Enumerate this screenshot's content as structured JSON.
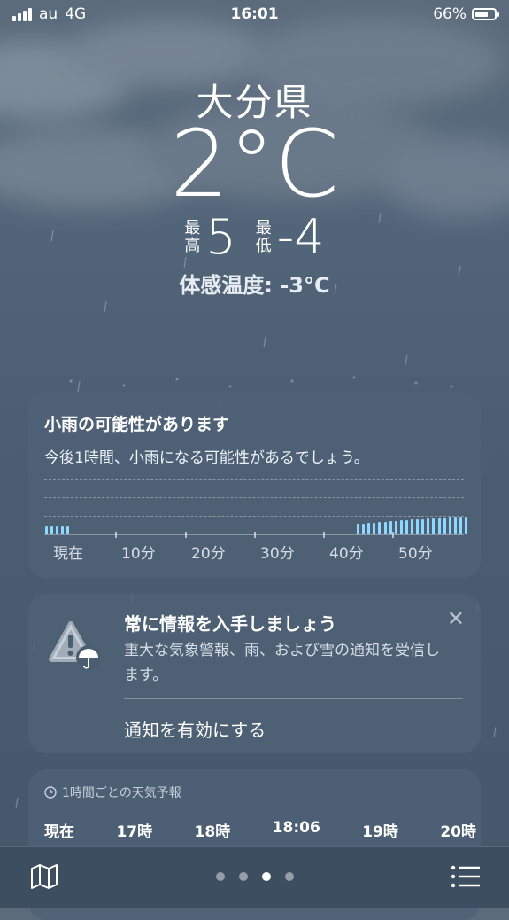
{
  "status_bar": {
    "carrier": "au",
    "network": "4G",
    "time": "16:01",
    "battery": "66%"
  },
  "header": {
    "location": "大分県",
    "temperature": "2°C",
    "high_label_1": "最",
    "high_label_2": "高",
    "high_value": "5",
    "low_label_1": "最",
    "low_label_2": "低",
    "low_value": "-4",
    "feels_like": "体感温度: -3°C"
  },
  "precip_card": {
    "title": "小雨の可能性があります",
    "subtitle": "今後1時間、小雨になる可能性があるでしょう。",
    "axis_labels": [
      "現在",
      "10分",
      "20分",
      "30分",
      "40分",
      "50分"
    ],
    "bar_color": "#8fd7ff"
  },
  "alert_card": {
    "title": "常に情報を入手しましょう",
    "body": "重大な気象警報、雨、および雪の通知を受信します。",
    "action": "通知を有効にする",
    "close": "✕"
  },
  "hourly_card": {
    "header": "1時間ごとの天気予報",
    "hours": [
      "現在",
      "17時",
      "18時",
      "18:06",
      "19時",
      "20時"
    ]
  },
  "page_dots": {
    "count": 4,
    "active_index": 2
  }
}
